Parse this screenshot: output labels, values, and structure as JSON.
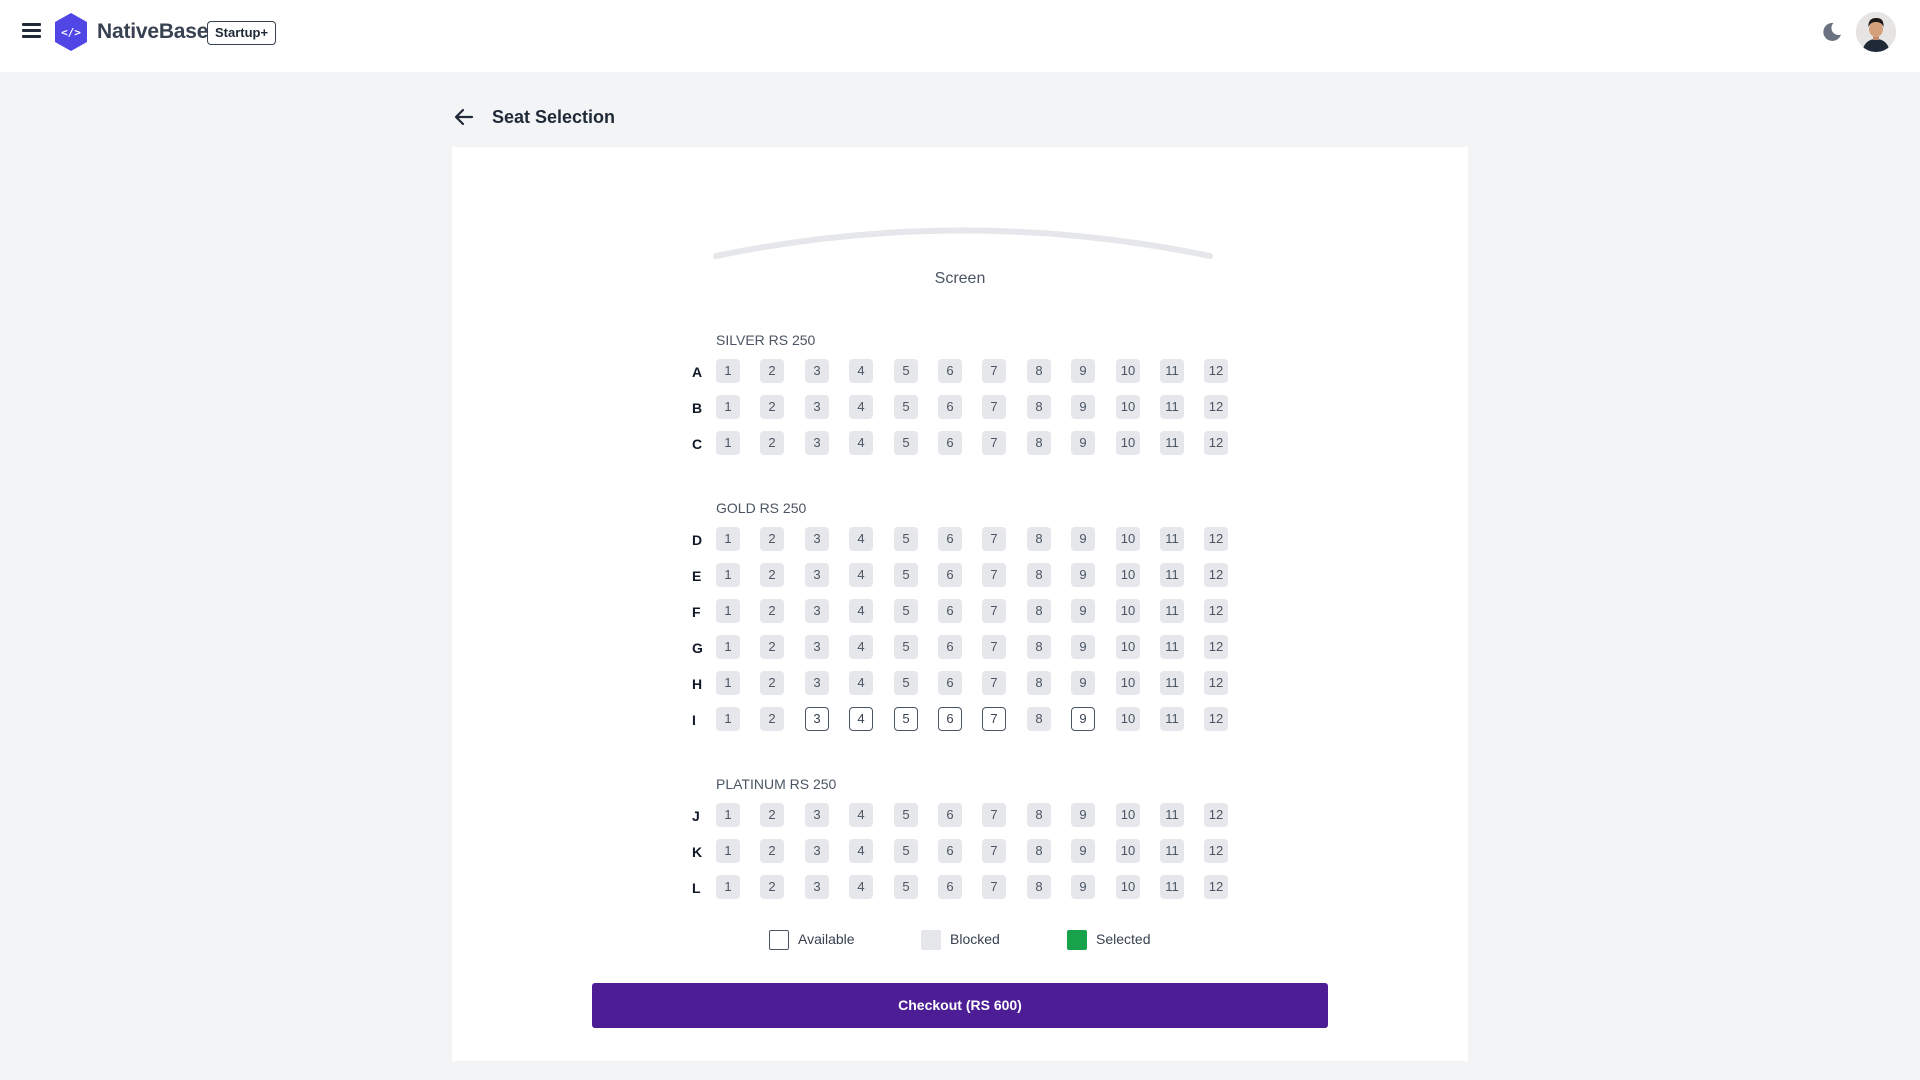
{
  "app": {
    "brand": "NativeBase",
    "plan_badge": "Startup+"
  },
  "header": {
    "icons": [
      "hamburger-menu-icon",
      "nativebase-logo",
      "moon-icon",
      "user-avatar"
    ]
  },
  "page": {
    "title": "Seat Selection",
    "back_icon": "arrow-left-icon"
  },
  "screen": {
    "label": "Screen"
  },
  "seat_numbers": [
    "1",
    "2",
    "3",
    "4",
    "5",
    "6",
    "7",
    "8",
    "9",
    "10",
    "11",
    "12"
  ],
  "sections": [
    {
      "label": "SILVER RS 250",
      "rows": [
        {
          "label": "A",
          "available": []
        },
        {
          "label": "B",
          "available": []
        },
        {
          "label": "C",
          "available": []
        }
      ]
    },
    {
      "label": "GOLD RS 250",
      "rows": [
        {
          "label": "D",
          "available": []
        },
        {
          "label": "E",
          "available": []
        },
        {
          "label": "F",
          "available": []
        },
        {
          "label": "G",
          "available": []
        },
        {
          "label": "H",
          "available": []
        },
        {
          "label": "I",
          "available": [
            "3",
            "4",
            "5",
            "6",
            "7",
            "9"
          ]
        }
      ]
    },
    {
      "label": "PLATINUM RS 250",
      "rows": [
        {
          "label": "J",
          "available": []
        },
        {
          "label": "K",
          "available": []
        },
        {
          "label": "L",
          "available": []
        }
      ]
    }
  ],
  "legend": {
    "available": "Available",
    "blocked": "Blocked",
    "selected": "Selected"
  },
  "colors": {
    "accent": "#4c1d95",
    "selected": "#16a34a",
    "blocked": "#e5e7eb",
    "logo": "#4f46e5"
  },
  "checkout": {
    "label": "Checkout (RS 600)"
  }
}
